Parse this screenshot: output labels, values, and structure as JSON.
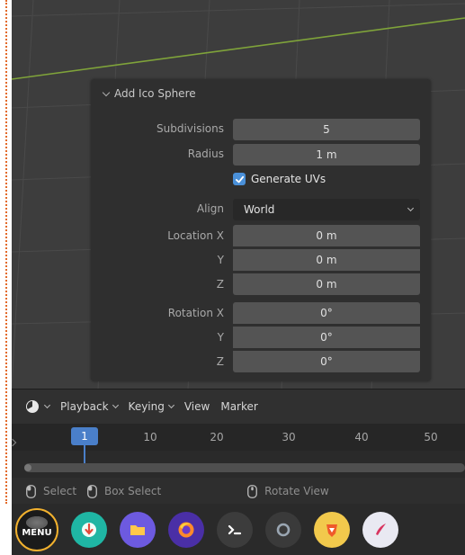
{
  "operator_panel": {
    "title": "Add Ico Sphere",
    "subdivisions": {
      "label": "Subdivisions",
      "value": "5"
    },
    "radius": {
      "label": "Radius",
      "value": "1 m"
    },
    "generate_uvs": {
      "label": "Generate UVs",
      "checked": true
    },
    "align": {
      "label": "Align",
      "value": "World"
    },
    "location": {
      "label": "Location X",
      "x": "0 m",
      "y_label": "Y",
      "y": "0 m",
      "z_label": "Z",
      "z": "0 m"
    },
    "rotation": {
      "label": "Rotation X",
      "x": "0°",
      "y_label": "Y",
      "y": "0°",
      "z_label": "Z",
      "z": "0°"
    }
  },
  "timeline": {
    "menus": [
      "Playback",
      "Keying",
      "View",
      "Marker"
    ],
    "current_frame": "1",
    "frame_labels": [
      "10",
      "20",
      "30",
      "40",
      "50"
    ]
  },
  "status_bar": {
    "select": "Select",
    "box_select": "Box Select",
    "rotate_view": "Rotate View"
  },
  "dock": {
    "menu_label": "MENU",
    "apps": [
      "software-center-icon",
      "files-icon",
      "firefox-icon",
      "terminal-icon",
      "system-icon",
      "brave-icon",
      "text-editor-icon"
    ]
  },
  "colors": {
    "accent_blue": "#4a7fc9",
    "checkbox_blue": "#4a90d9",
    "viewport_bg": "#3d3d3d",
    "menu_ring": "#f2b12e"
  }
}
